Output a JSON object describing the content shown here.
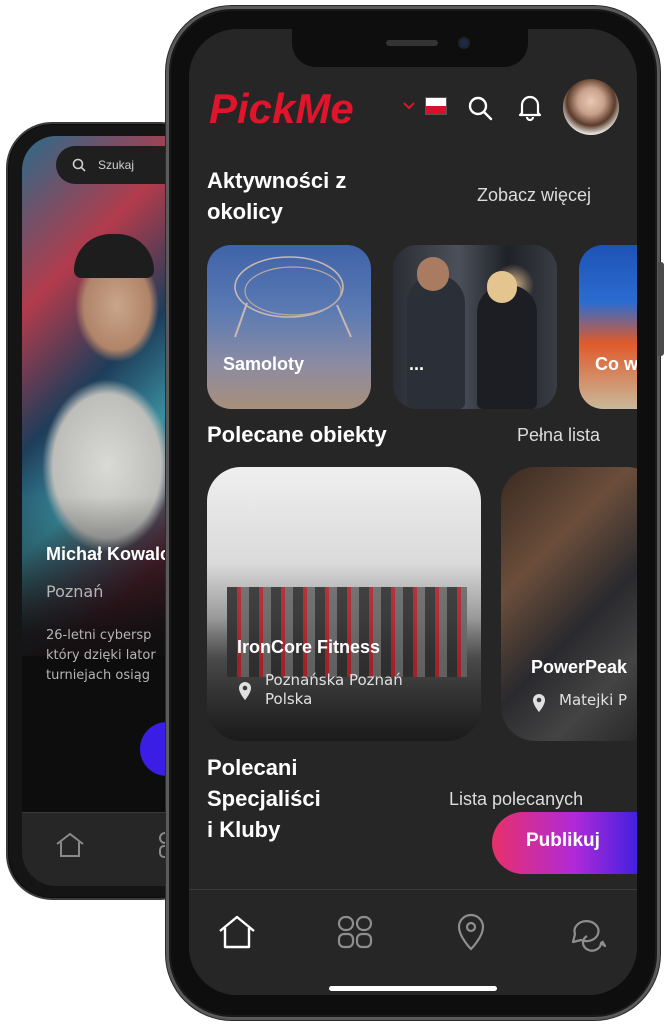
{
  "back_phone": {
    "search_placeholder": "Szukaj",
    "profile_name": "Michał Kowalc",
    "profile_city": "Poznań",
    "bio_lines": [
      "26-letni cybersp",
      "który dzięki lator",
      "turniejach osiąg"
    ]
  },
  "header": {
    "logo_text": "PickMe",
    "language_flag": "pl"
  },
  "activities": {
    "title_line1": "Aktywności z",
    "title_line2": "okolicy",
    "see_more": "Zobacz więcej",
    "items": [
      {
        "label": "Samoloty"
      },
      {
        "label": "..."
      },
      {
        "label": "Co w"
      }
    ]
  },
  "objects": {
    "title": "Polecane obiekty",
    "link": "Pełna lista",
    "items": [
      {
        "name": "IronCore Fitness",
        "addr_line1": "Poznańska  Poznań",
        "addr_line2": "Polska"
      },
      {
        "name": "PowerPeak",
        "addr_line1": "Matejki  P"
      }
    ]
  },
  "specialists": {
    "title_line1": "Polecani",
    "title_line2": "Specjaliści",
    "title_line3": "i Kluby",
    "link": "Lista polecanych"
  },
  "fab": {
    "label": "Publikuj"
  },
  "tabbar": {
    "icons": [
      "home-icon",
      "users-icon",
      "map-pin-icon",
      "chat-icon"
    ]
  },
  "colors": {
    "brand_red": "#e0142a",
    "background": "#262626",
    "fab_gradient_start": "#e8306a",
    "fab_gradient_end": "#3a1fe0"
  }
}
